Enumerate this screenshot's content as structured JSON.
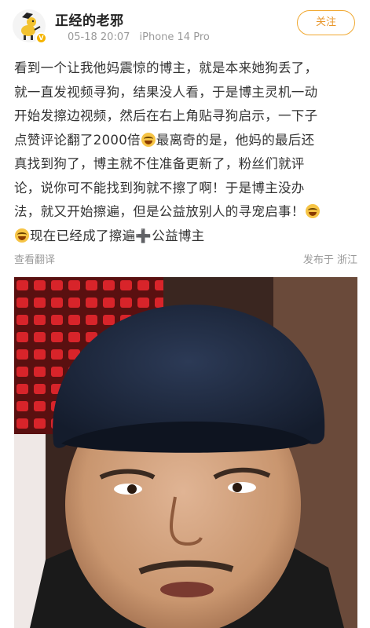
{
  "header": {
    "username": "正经的老邪",
    "timestamp": "05-18 20:07",
    "device": "iPhone 14 Pro",
    "follow_label": "关注",
    "avatar_icon": "yellow-cartoon-mascot-icon",
    "badge_icon": "vip-badge-icon"
  },
  "post": {
    "lines": [
      "看到一个让我他妈震惊的博主，就是本来她狗丢了，",
      "就一直发视频寻狗，结果没人看，于是博主灵机一动",
      "开始发擦边视频，然后在右上角贴寻狗启示，一下子",
      "点赞评论翻了2000倍",
      "最离奇的是，他妈的最后还",
      "真找到狗了，博主就不住准备更新了，粉丝们就评",
      "论，说你可不能找到狗就不擦了啊！于是博主没办",
      "法，就又开始擦遍，但是公益放别人的寻宠启事！",
      "现在已经成了擦遍",
      "公益博主"
    ],
    "emoji_icon": "laughing-crying-emoji-icon",
    "plus_glyph": "➕"
  },
  "footer": {
    "translate_label": "查看翻译",
    "location_label": "发布于 浙江"
  },
  "image": {
    "alt_icon": "meme-man-with-flat-cap-image"
  },
  "colors": {
    "accent": "#f0a830",
    "meta_text": "#9a9a9a",
    "body_text": "#333333"
  }
}
